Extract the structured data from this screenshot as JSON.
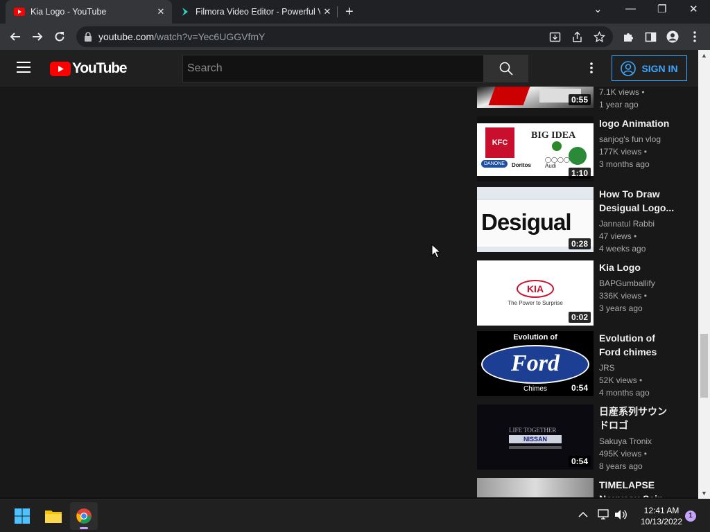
{
  "browser": {
    "tabs": [
      {
        "title": "Kia Logo - YouTube",
        "close": "✕"
      },
      {
        "title": "Filmora Video Editor - Powerful V",
        "close": "✕"
      }
    ],
    "new_tab": "+",
    "url_host": "youtube.com",
    "url_path": "/watch?v=Yec6UGGVfmY",
    "window_controls": [
      "⌄",
      "—",
      "❐",
      "✕"
    ]
  },
  "youtube": {
    "logo_text": "YouTube",
    "search_placeholder": "Search",
    "sign_in_label": "SIGN IN",
    "brand_color": "#ff0000",
    "link_color": "#3ea6ff"
  },
  "thumb_text": {
    "kfc": "KFC",
    "big_idea": "BIG IDEA",
    "danone": "DANONE",
    "doritos": "Doritos",
    "audi": "Audi",
    "desigual": "Desigual",
    "kia": "KIA",
    "kia_tagline": "The Power to Surprise",
    "ford_top": "Evolution of",
    "ford": "Ford",
    "ford_bottom": "Chimes",
    "life_together": "LIFE TOGETHER",
    "nissan": "NISSAN"
  },
  "videos": [
    {
      "title": "",
      "channel": "",
      "views": "7.1K views",
      "age": "1 year ago",
      "duration": "0:55"
    },
    {
      "title": "logo Animation",
      "channel": "sanjog's fun vlog",
      "views": "177K views",
      "age": "3 months ago",
      "duration": "1:10"
    },
    {
      "title": "How To Draw Desigual Logo...",
      "channel": "Jannatul Rabbi",
      "views": "47 views",
      "age": "4 weeks ago",
      "duration": "0:28"
    },
    {
      "title": "Kia Logo",
      "channel": "BAPGumballify",
      "views": "336K views",
      "age": "3 years ago",
      "duration": "0:02"
    },
    {
      "title": "Evolution of Ford chimes",
      "channel": "JRS",
      "views": "52K views",
      "age": "4 months ago",
      "duration": "0:54"
    },
    {
      "title": "日産系列サウンドロゴ",
      "channel": "Sakuya Tronix",
      "views": "495K views",
      "age": "8 years ago",
      "duration": "0:54"
    },
    {
      "title": "TIMELAPSE Nouveau Sain",
      "channel": "",
      "views": "",
      "age": "",
      "duration": ""
    }
  ],
  "taskbar": {
    "time": "12:41 AM",
    "date": "10/13/2022",
    "notifications": "1",
    "apps": [
      "start-icon",
      "file-explorer-icon",
      "chrome-icon"
    ]
  }
}
